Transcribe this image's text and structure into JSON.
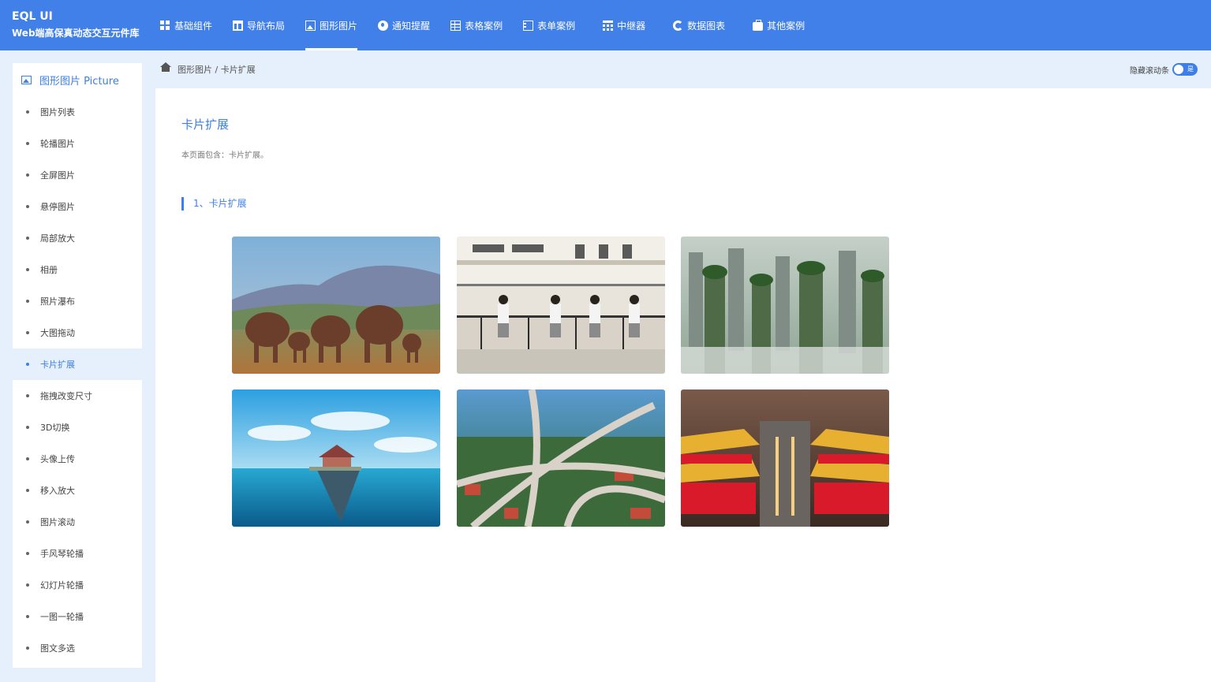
{
  "brand": {
    "title": "EQL UI",
    "subtitle": "Web端高保真动态交互元件库"
  },
  "nav": [
    {
      "label": "基础组件",
      "icon": "grid-icon"
    },
    {
      "label": "导航布局",
      "icon": "layout-icon"
    },
    {
      "label": "图形图片",
      "icon": "picture-icon",
      "active": true
    },
    {
      "label": "通知提醒",
      "icon": "drop-icon"
    },
    {
      "label": "表格案例",
      "icon": "table-icon"
    },
    {
      "label": "表单案例",
      "icon": "form-icon"
    },
    {
      "label": "中继器",
      "icon": "relay-icon"
    },
    {
      "label": "数据图表",
      "icon": "chart-icon"
    },
    {
      "label": "其他案例",
      "icon": "briefcase-icon"
    }
  ],
  "sidebar": {
    "header": "图形图片 Picture",
    "items": [
      "图片列表",
      "轮播图片",
      "全屏图片",
      "悬停图片",
      "局部放大",
      "相册",
      "照片瀑布",
      "大图拖动",
      "卡片扩展",
      "拖拽改变尺寸",
      "3D切换",
      "头像上传",
      "移入放大",
      "图片滚动",
      "手风琴轮播",
      "幻灯片轮播",
      "一图一轮播",
      "图文多选"
    ],
    "active_index": 8
  },
  "breadcrumb": {
    "text": "图形图片 / 卡片扩展"
  },
  "toggle": {
    "label": "隐藏滚动条",
    "state_text": "是"
  },
  "main": {
    "title": "卡片扩展",
    "description": "本页面包含：卡片扩展。",
    "section_title": "1、卡片扩展"
  },
  "cards": [
    {
      "name": "elephants-image"
    },
    {
      "name": "school-students-image"
    },
    {
      "name": "mountain-peaks-image"
    },
    {
      "name": "floating-house-image"
    },
    {
      "name": "highway-interchange-image"
    },
    {
      "name": "night-palace-image"
    }
  ]
}
